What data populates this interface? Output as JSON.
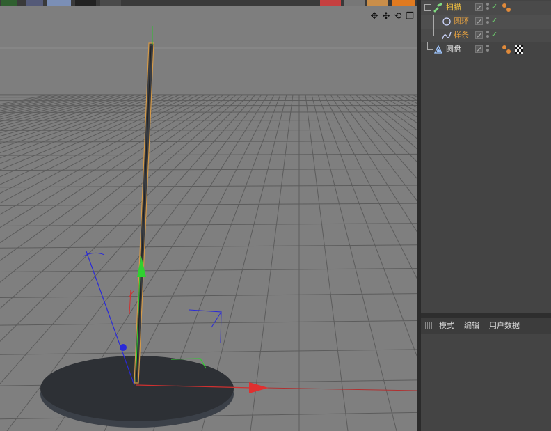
{
  "objects": [
    {
      "name": "扫描",
      "type": "sweep",
      "color": "#f0c040",
      "check": "✓"
    },
    {
      "name": "圆环",
      "type": "circle",
      "color": "#e4a040",
      "check": "✓"
    },
    {
      "name": "样条",
      "type": "spline",
      "color": "#e4a040",
      "check": "✓"
    },
    {
      "name": "圆盘",
      "type": "disc",
      "color": "#dddddd",
      "check": ""
    }
  ],
  "attributes": {
    "menu": [
      "模式",
      "编辑",
      "用户数据"
    ]
  },
  "icons": {
    "nav": [
      "move-icon",
      "pan-icon",
      "rotate-icon",
      "maximize-icon"
    ],
    "tree": [
      "sweep-icon",
      "circle-icon",
      "spline-icon",
      "disc-icon"
    ]
  },
  "colors": {
    "viewport_bg": "#7f7f7f",
    "grid": "#5e5e5e",
    "selection_outline": "#d59a48",
    "axis_x": "#e03030",
    "axis_y": "#30d030",
    "axis_z": "#2a2ad8",
    "disc": "#2d3035",
    "highlight_text": "#f0c040"
  }
}
